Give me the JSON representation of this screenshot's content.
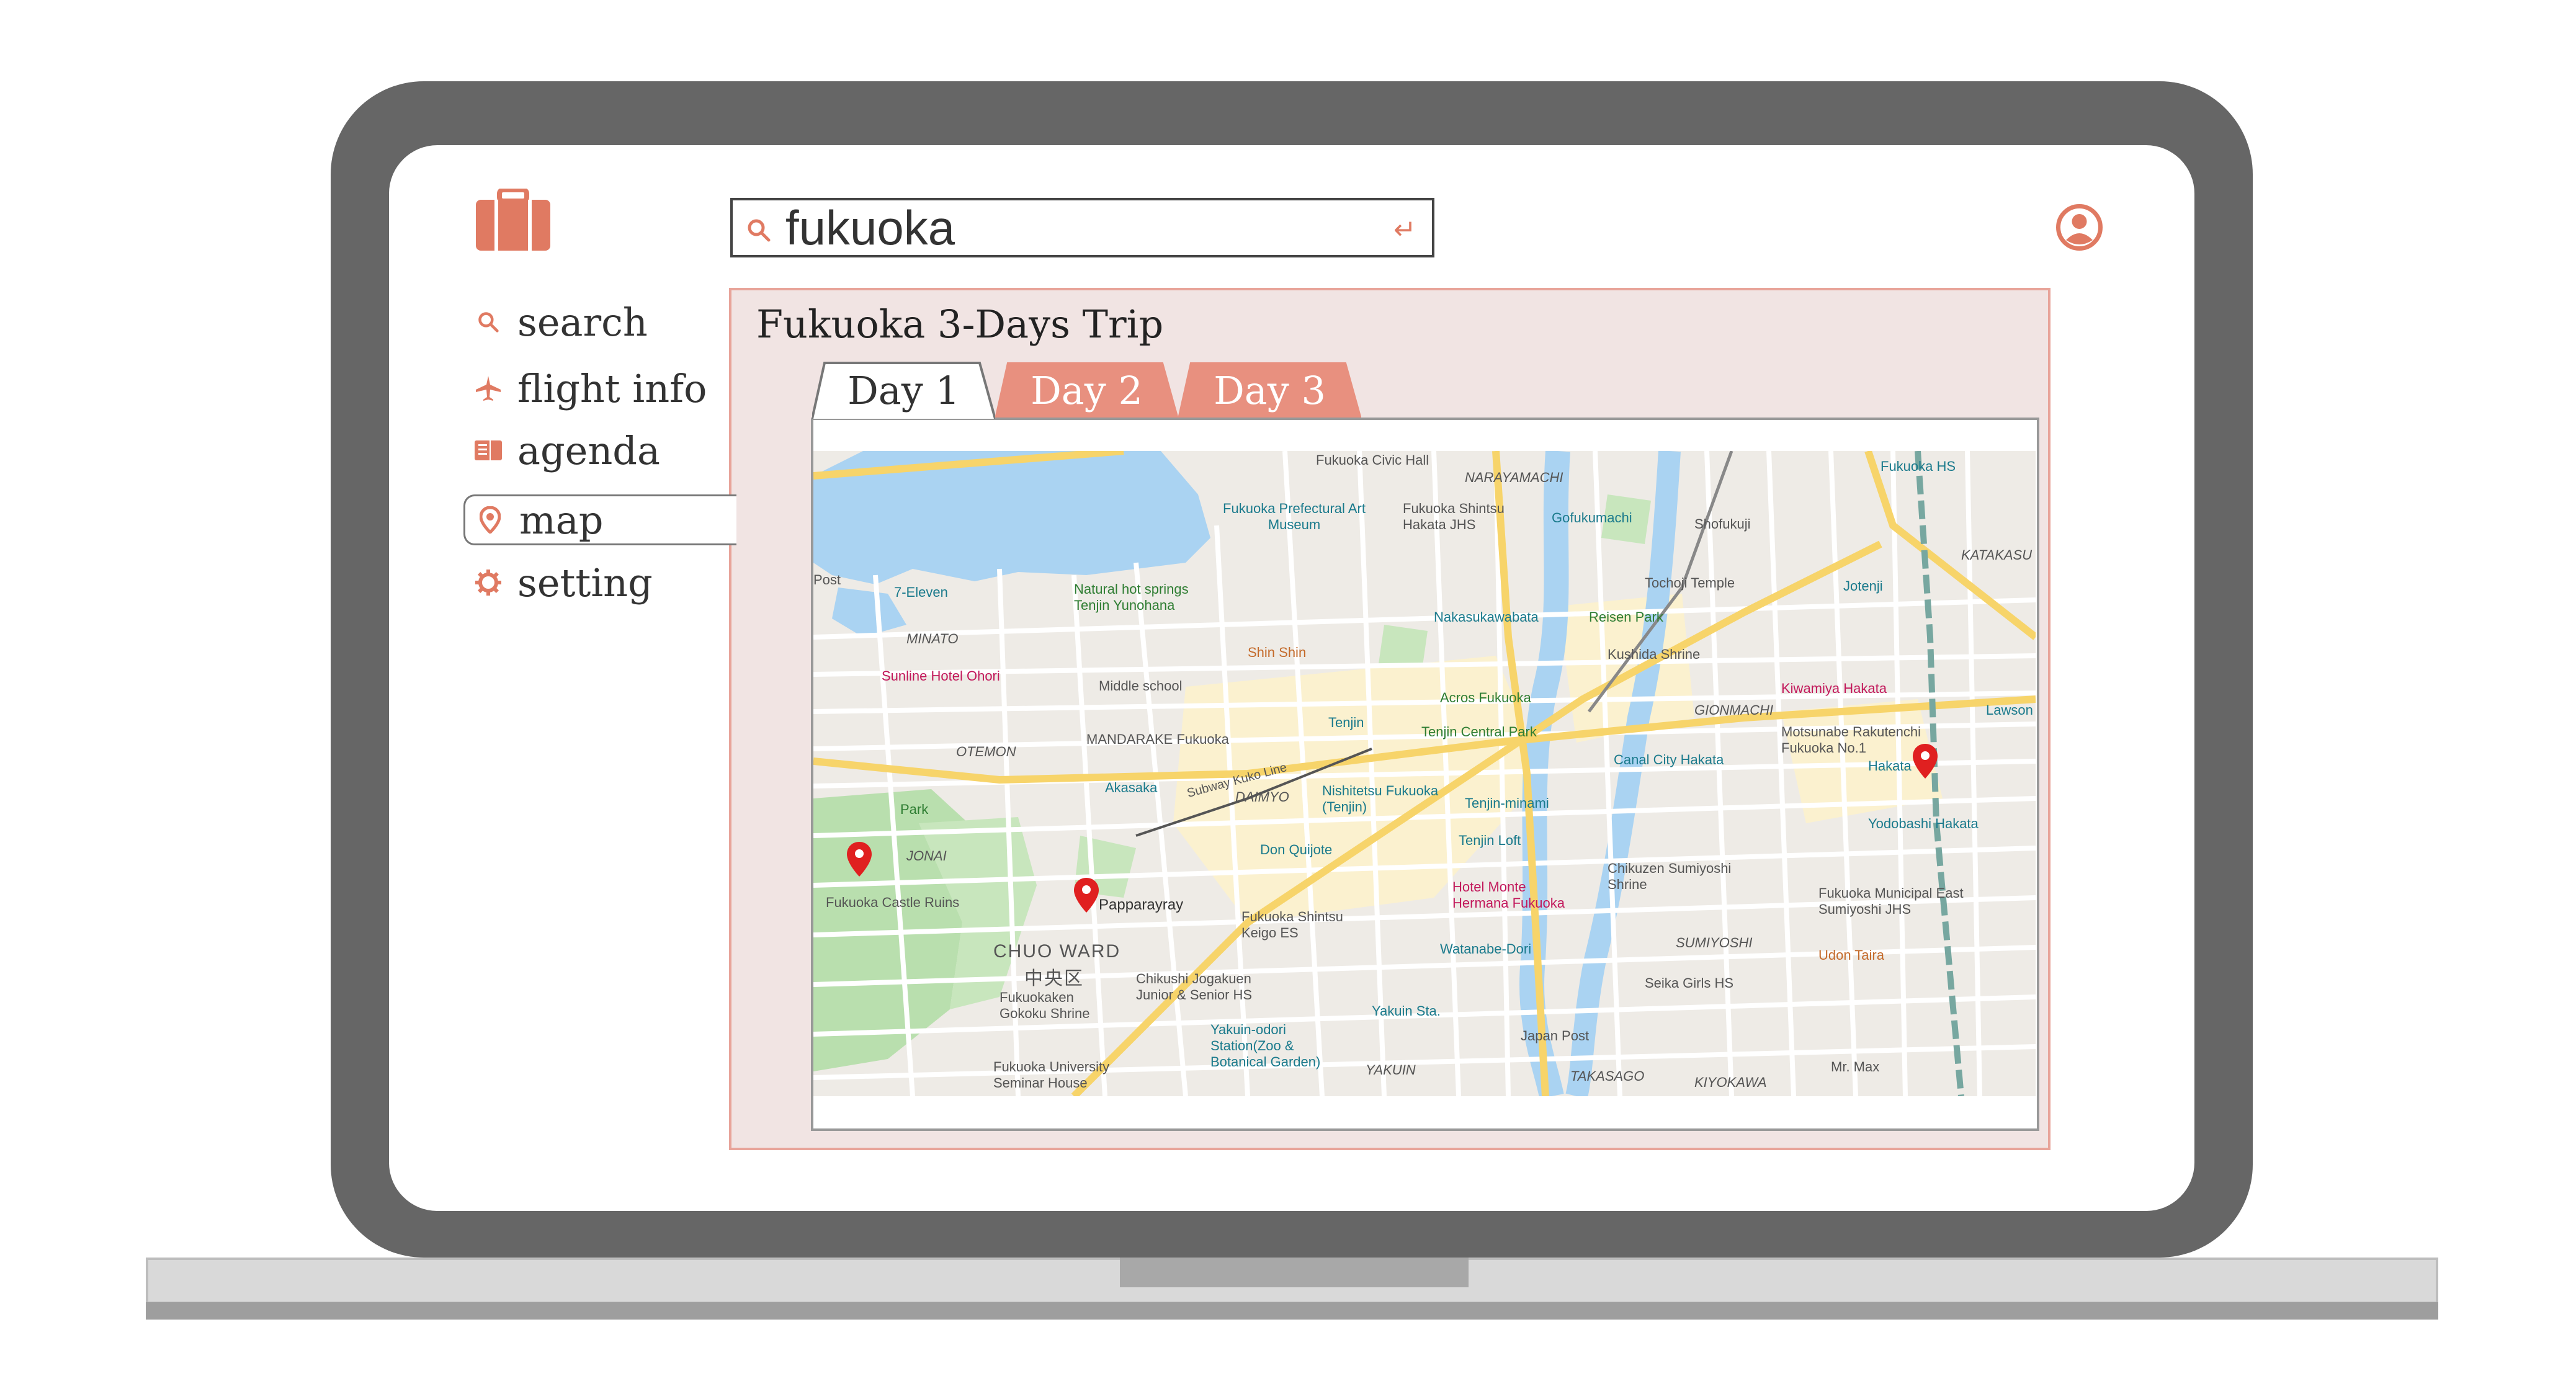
{
  "search": {
    "value": "fukuoka"
  },
  "nav": {
    "items": [
      {
        "label": "search",
        "icon": "search-icon"
      },
      {
        "label": "flight info",
        "icon": "airplane-icon"
      },
      {
        "label": "agenda",
        "icon": "book-icon"
      },
      {
        "label": "map",
        "icon": "location-pin-icon",
        "selected": true
      },
      {
        "label": "setting",
        "icon": "gear-icon"
      }
    ]
  },
  "trip": {
    "title": "Fukuoka 3-Days Trip",
    "tabs": [
      {
        "label": "Day 1",
        "active": true
      },
      {
        "label": "Day 2",
        "active": false
      },
      {
        "label": "Day 3",
        "active": false
      }
    ]
  },
  "map": {
    "labels": {
      "civic_hall": "Fukuoka Civic Hall",
      "prefectural_museum": "Fukuoka Prefectural Art Museum",
      "shinto": "Fukuoka Shintsu Hakata JHS",
      "gofukumachi": "Gofukumachi",
      "natural_springs": "Natural hot springs Tenjin Yunohana",
      "seven_eleven": "7-Eleven",
      "minato": "MINATO",
      "sunline": "Sunline Hotel Ohori",
      "shin_shin": "Shin Shin",
      "middle_school": "Middle school",
      "nakasukawabata": "Nakasukawabata",
      "reisen_park": "Reisen Park",
      "kushida": "Kushida Shrine",
      "tochoji": "Tochoji Temple",
      "mandarake": "MANDARAKE Fukuoka",
      "tenjin": "Tenjin",
      "acros": "Acros Fukuoka",
      "tenjin_central": "Tenjin Central Park",
      "gionmachi": "GIONMACHI",
      "kiwamiya": "Kiwamiya Hakata",
      "motsunabe": "Motsunabe Rakutenchi Fukuoka No.1",
      "otemon": "OTEMON",
      "akasaka": "Akasaka",
      "subway": "Subway Kuko Line",
      "daimyo": "DAIMYO",
      "nishitetsu": "Nishitetsu Fukuoka (Tenjin)",
      "canal_city": "Canal City Hakata",
      "tenjin_minami": "Tenjin-minami",
      "hakata": "Hakata",
      "yodobashi": "Yodobashi Hakata",
      "jonai": "JONAI",
      "don_quijote": "Don Quijote",
      "tenjin_loft": "Tenjin Loft",
      "castle_ruins": "Fukuoka Castle Ruins",
      "papparayray": "Papparayray",
      "chuo_ward": "CHUO WARD",
      "chuo_ku": "中央区",
      "hotel_monte": "Hotel Monte Hermana Fukuoka",
      "chikuzen": "Chikuzen Sumiyoshi Shrine",
      "shintsu_keigo": "Fukuoka Shintsu Keigo ES",
      "watanabe": "Watanabe-Dori",
      "sumiyoshi": "SUMIYOSHI",
      "east_sumiyoshi": "Fukuoka Municipal East Sumiyoshi JHS",
      "gokoku": "Fukuokaken Gokoku Shrine",
      "chikushi": "Chikushi Jogakuen Junior & Senior HS",
      "seika": "Seika Girls HS",
      "udon_taira": "Udon Taira",
      "yakuin_odori": "Yakuin-odori Station(Zoo & Botanical Garden)",
      "yakuin_sta": "Yakuin Sta.",
      "japan_post": "Japan Post",
      "university": "Fukuoka University Seminar House",
      "yakuin": "YAKUIN",
      "takasago": "TAKASAGO",
      "kiyokawa": "KIYOKAWA",
      "mr_max": "Mr. Max",
      "katakasu": "KATAKASU",
      "jotenji": "Jotenji",
      "narayamachi": "NARAYAMACHI",
      "shofukuji": "Shofukuji",
      "lawson": "Lawson",
      "post": "Post",
      "park": "Park",
      "fukuoka_hs": "Fukuoka HS"
    }
  },
  "colors": {
    "accent": "#e07a62",
    "tab_inactive": "#e8907f",
    "panel_bg": "#f1e4e3",
    "panel_border": "#e8a49a",
    "bezel": "#666666",
    "pin": "#e02020"
  }
}
